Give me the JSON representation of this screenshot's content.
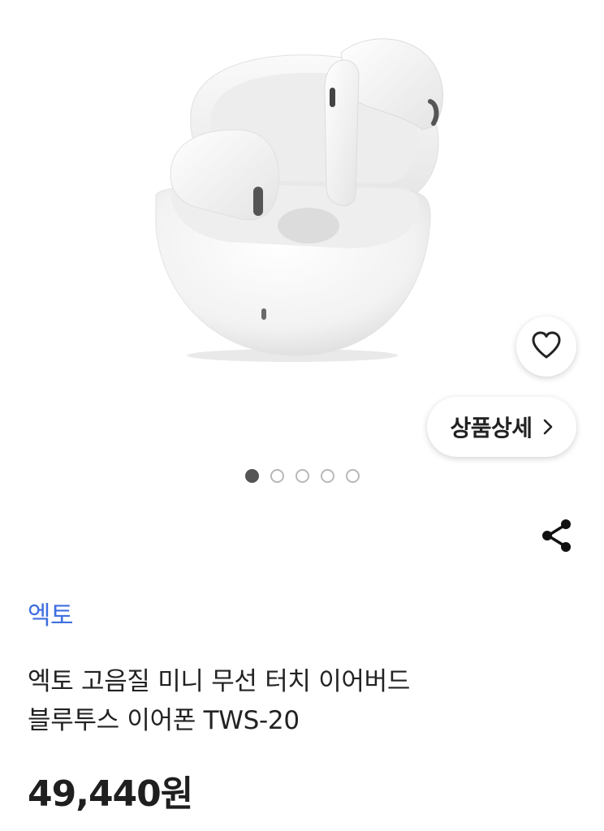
{
  "product": {
    "brand": "엑토",
    "title_line1": "엑토 고음질 미니 무선 터치 이어버드",
    "title_line2": "블루투스 이어폰 TWS-20",
    "price": "49,440원"
  },
  "actions": {
    "detail_label": "상품상세",
    "wish_icon": "heart-icon",
    "share_icon": "share-icon",
    "detail_icon": "chevron-right-icon"
  },
  "gallery": {
    "image": "white-wireless-earbuds-in-open-case",
    "total_images": 5,
    "current_image": 1
  },
  "colors": {
    "brand": "#3f6fe0",
    "text": "#222222",
    "dot_active": "#555555",
    "dot_inactive": "#b8b8b8"
  }
}
